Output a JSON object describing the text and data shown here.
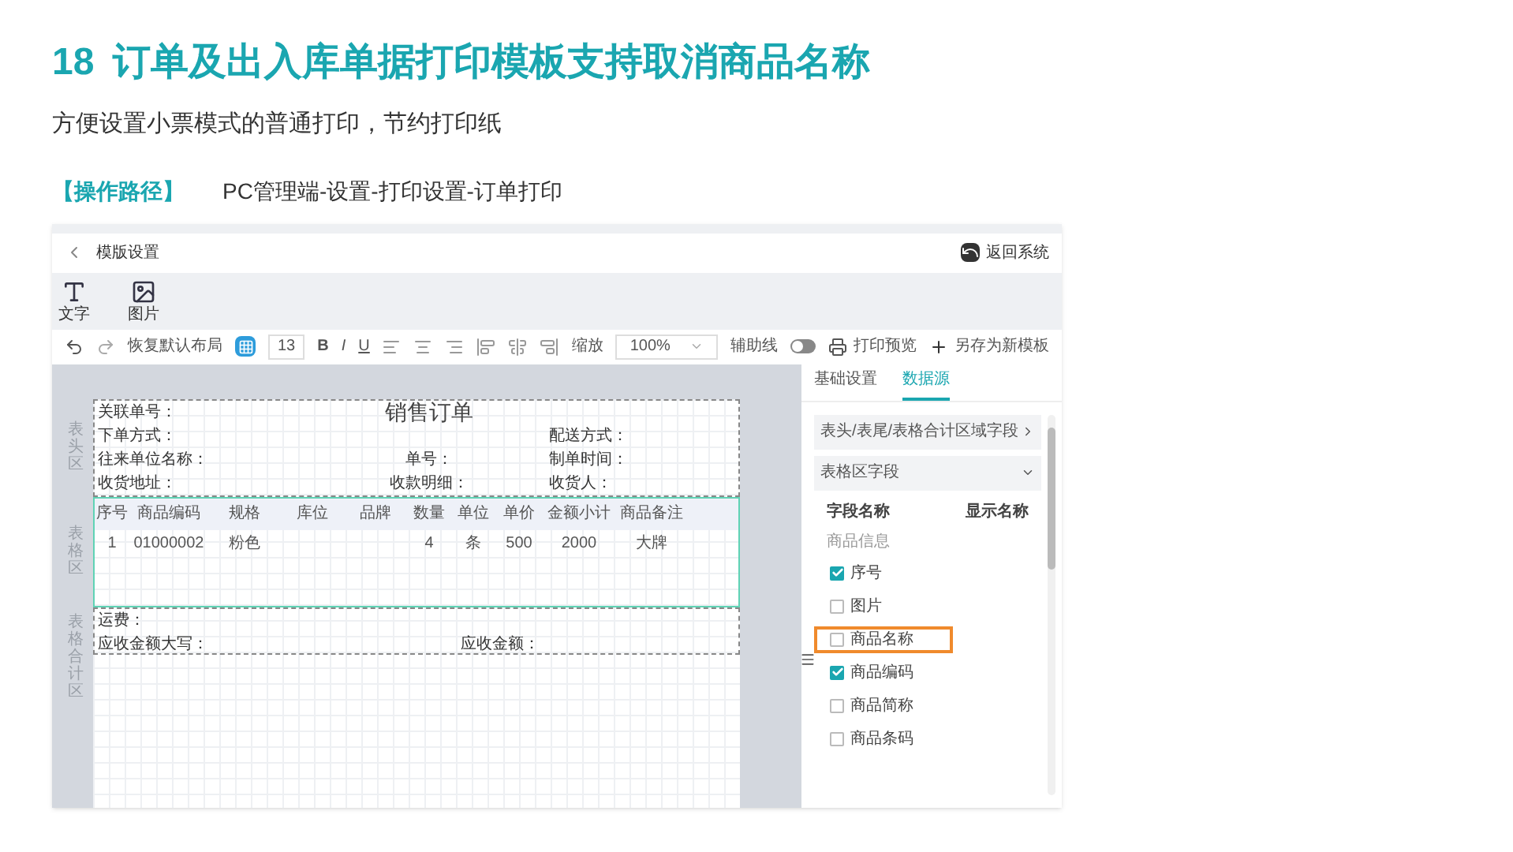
{
  "slide": {
    "number": "18",
    "title": "订单及出入库单据打印模板支持取消商品名称",
    "subtitle": "方便设置小票模式的普通打印，节约打印纸",
    "path_label": "【操作路径】",
    "path": "PC管理端-设置-打印设置-订单打印"
  },
  "app": {
    "title": "模版设置",
    "back": "返回系统",
    "palette": [
      {
        "kind": "text",
        "label": "文字"
      },
      {
        "kind": "image",
        "label": "图片"
      }
    ],
    "toolbar": {
      "reset": "恢复默认布局",
      "grid_on": true,
      "font_size": "13",
      "bold": "B",
      "italic": "I",
      "underline": "U",
      "zoom_label": "缩放",
      "zoom": "100%",
      "guides_label": "辅助线",
      "guides_on": false,
      "preview": "打印预览",
      "save_as": "另存为新模板"
    },
    "header_zone": {
      "label": "表头区",
      "title": "销售订单",
      "rows": [
        {
          "left": "关联单号："
        },
        {
          "left": "下单方式：",
          "right": "配送方式："
        },
        {
          "left": "往来单位名称：",
          "middle": "单号：",
          "right": "制单时间："
        },
        {
          "left": "收货地址：",
          "middle": "收款明细：",
          "right": "收货人："
        }
      ]
    },
    "table_zone": {
      "label": "表格区",
      "columns": [
        {
          "label": "序号",
          "value": "1"
        },
        {
          "label": "商品编码",
          "value": "01000002"
        },
        {
          "label": "规格",
          "value": "粉色"
        },
        {
          "label": "库位"
        },
        {
          "label": "品牌"
        },
        {
          "label": "数量",
          "value": "4"
        },
        {
          "label": "单位",
          "value": "条"
        },
        {
          "label": "单价",
          "value": "500"
        },
        {
          "label": "金额小计",
          "value": "2000"
        },
        {
          "label": "商品备注",
          "value": "大牌"
        }
      ]
    },
    "totals_zone": {
      "label": "表格合计区",
      "freight": "运费：",
      "amount_words": "应收金额大写：",
      "amount": "应收金额："
    },
    "panel": {
      "tabs": [
        {
          "label": "基础设置",
          "selected": false
        },
        {
          "label": "数据源",
          "selected": true
        }
      ],
      "sections": [
        {
          "label": "表头/表尾/表格合计区域字段",
          "expanded": false
        },
        {
          "label": "表格区字段",
          "expanded": true
        }
      ],
      "field_header": "字段名称",
      "display_header": "显示名称",
      "group": "商品信息",
      "fields": [
        {
          "label": "序号",
          "checked": true,
          "highlighted": false
        },
        {
          "label": "图片",
          "checked": false,
          "highlighted": false
        },
        {
          "label": "商品名称",
          "checked": false,
          "highlighted": true
        },
        {
          "label": "商品编码",
          "checked": true,
          "highlighted": false
        },
        {
          "label": "商品简称",
          "checked": false,
          "highlighted": false
        },
        {
          "label": "商品条码",
          "checked": false,
          "highlighted": false
        }
      ]
    }
  }
}
